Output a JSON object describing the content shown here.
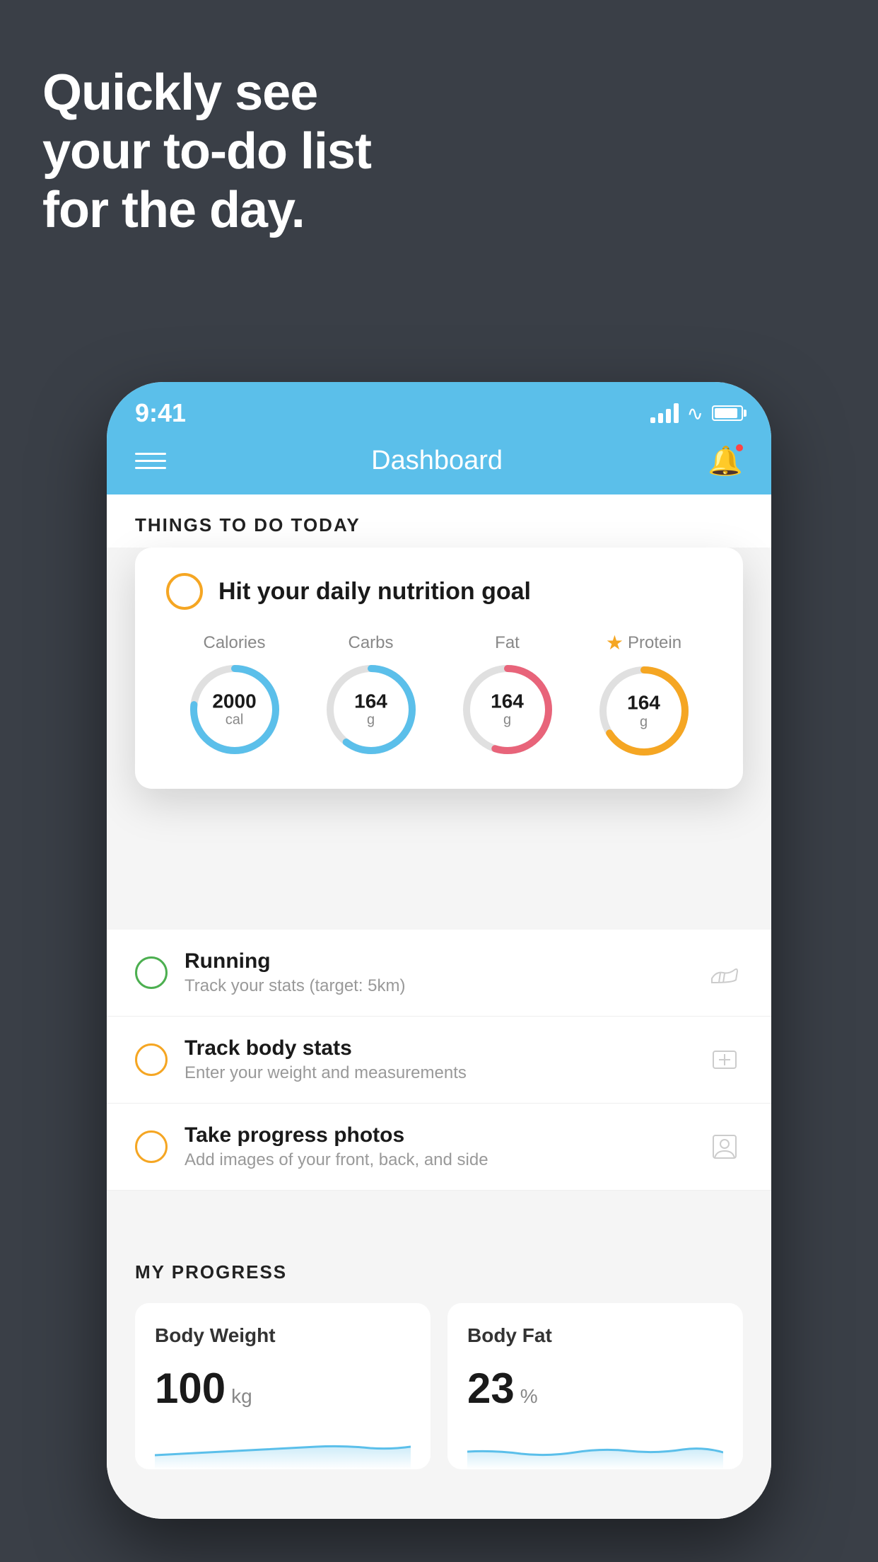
{
  "headline": {
    "line1": "Quickly see",
    "line2": "your to-do list",
    "line3": "for the day."
  },
  "status_bar": {
    "time": "9:41"
  },
  "nav": {
    "title": "Dashboard"
  },
  "things_today": {
    "section_title": "THINGS TO DO TODAY"
  },
  "nutrition_card": {
    "title": "Hit your daily nutrition goal",
    "items": [
      {
        "label": "Calories",
        "value": "2000",
        "unit": "cal",
        "color": "#5bbfea",
        "track_color": "#e0e0e0"
      },
      {
        "label": "Carbs",
        "value": "164",
        "unit": "g",
        "color": "#5bbfea",
        "track_color": "#e0e0e0"
      },
      {
        "label": "Fat",
        "value": "164",
        "unit": "g",
        "color": "#e8647a",
        "track_color": "#e0e0e0"
      },
      {
        "label": "Protein",
        "value": "164",
        "unit": "g",
        "color": "#f5a623",
        "track_color": "#e0e0e0",
        "starred": true
      }
    ]
  },
  "todo_items": [
    {
      "name": "Running",
      "desc": "Track your stats (target: 5km)",
      "circle_color": "green",
      "icon": "shoe"
    },
    {
      "name": "Track body stats",
      "desc": "Enter your weight and measurements",
      "circle_color": "orange",
      "icon": "scale"
    },
    {
      "name": "Take progress photos",
      "desc": "Add images of your front, back, and side",
      "circle_color": "orange",
      "icon": "person"
    }
  ],
  "progress": {
    "section_title": "MY PROGRESS",
    "cards": [
      {
        "title": "Body Weight",
        "value": "100",
        "unit": "kg"
      },
      {
        "title": "Body Fat",
        "value": "23",
        "unit": "%"
      }
    ]
  }
}
